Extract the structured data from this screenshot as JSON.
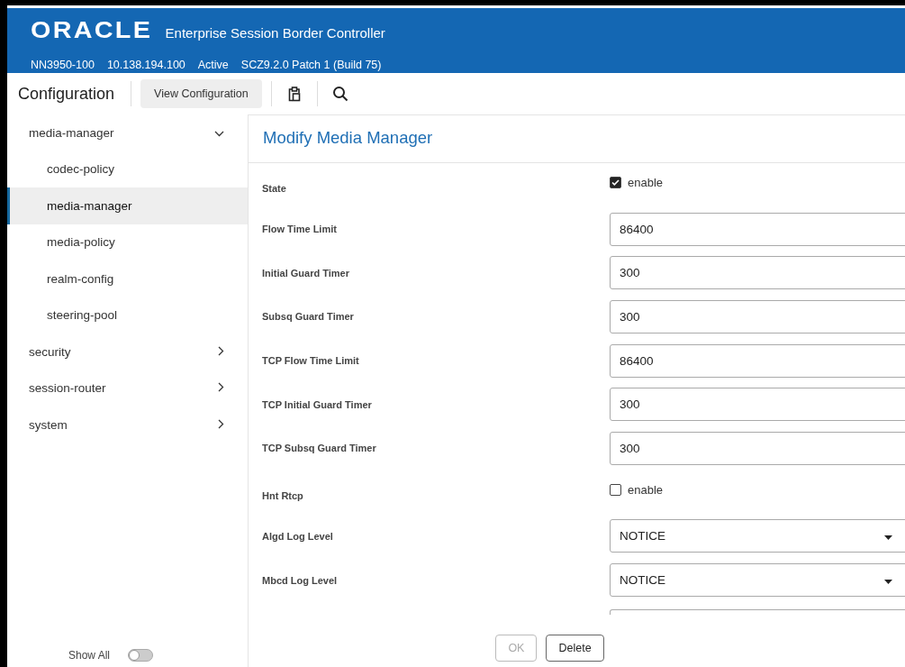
{
  "header": {
    "logo": "ORACLE",
    "product": "Enterprise Session Border Controller",
    "info": [
      "NN3950-100",
      "10.138.194.100",
      "Active",
      "SCZ9.2.0 Patch 1 (Build 75)"
    ]
  },
  "toolbar": {
    "title": "Configuration",
    "view_button": "View Configuration"
  },
  "sidebar": {
    "items": [
      {
        "label": "media-manager",
        "expanded": true,
        "selected": false,
        "children": [
          {
            "label": "codec-policy",
            "selected": false
          },
          {
            "label": "media-manager",
            "selected": true
          },
          {
            "label": "media-policy",
            "selected": false
          },
          {
            "label": "realm-config",
            "selected": false
          },
          {
            "label": "steering-pool",
            "selected": false
          }
        ]
      },
      {
        "label": "security",
        "expanded": false,
        "selected": false
      },
      {
        "label": "session-router",
        "expanded": false,
        "selected": false
      },
      {
        "label": "system",
        "expanded": false,
        "selected": false
      }
    ],
    "show_all": {
      "label": "Show All",
      "on": false
    }
  },
  "form": {
    "title": "Modify Media Manager",
    "fields": [
      {
        "kind": "checkbox",
        "label": "State",
        "option": "enable",
        "checked": true
      },
      {
        "kind": "text",
        "label": "Flow Time Limit",
        "value": "86400"
      },
      {
        "kind": "text",
        "label": "Initial Guard Timer",
        "value": "300"
      },
      {
        "kind": "text",
        "label": "Subsq Guard Timer",
        "value": "300"
      },
      {
        "kind": "text",
        "label": "TCP Flow Time Limit",
        "value": "86400"
      },
      {
        "kind": "text",
        "label": "TCP Initial Guard Timer",
        "value": "300"
      },
      {
        "kind": "text",
        "label": "TCP Subsq Guard Timer",
        "value": "300"
      },
      {
        "kind": "checkbox",
        "label": "Hnt Rtcp",
        "option": "enable",
        "checked": false
      },
      {
        "kind": "select",
        "label": "Algd Log Level",
        "value": "NOTICE"
      },
      {
        "kind": "select",
        "label": "Mbcd Log Level",
        "value": "NOTICE"
      }
    ],
    "buttons": [
      {
        "label": "OK",
        "disabled": true
      },
      {
        "label": "Delete",
        "disabled": false
      }
    ]
  }
}
